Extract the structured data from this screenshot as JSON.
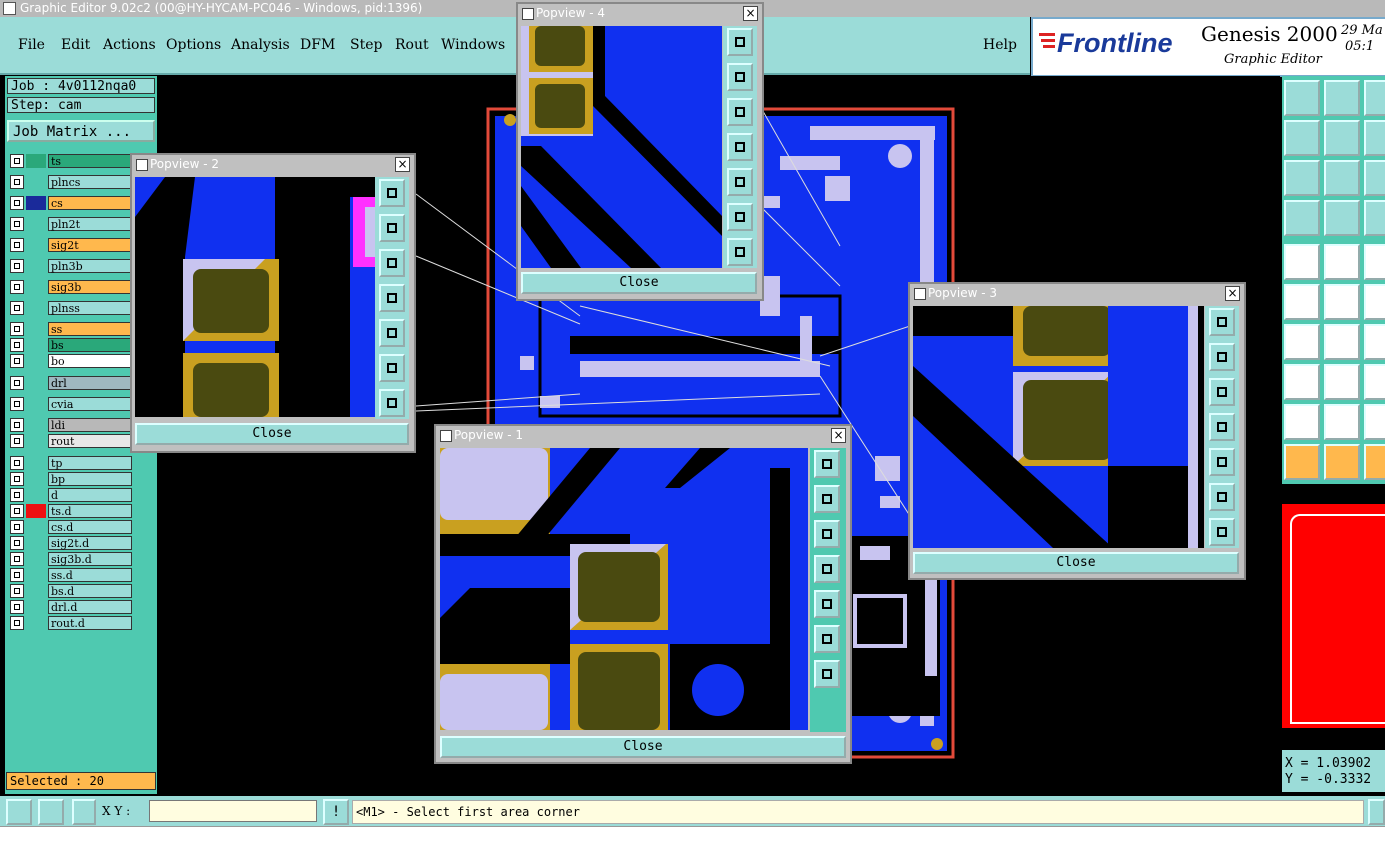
{
  "window": {
    "title": "Graphic Editor 9.02c2 (00@HY-HYCAM-PC046 - Windows, pid:1396)"
  },
  "menu": [
    "File",
    "Edit",
    "Actions",
    "Options",
    "Analysis",
    "DFM",
    "Step",
    "Rout",
    "Windows"
  ],
  "help": "Help",
  "logo": {
    "brand": "Frontline",
    "product": "Genesis 2000",
    "subtitle": "Graphic Editor",
    "date": "29 Ma",
    "time": "05:1"
  },
  "job": {
    "job_label": "Job : 4v0112nqa0",
    "step_label": "Step: cam",
    "matrix_button": "Job Matrix ..."
  },
  "layers": [
    {
      "name": "ts",
      "color": "#2aa87a"
    },
    {
      "name": "plncs",
      "color": "#9bdcd8"
    },
    {
      "name": "cs",
      "color": "#ffb84d"
    },
    {
      "name": "pln2t",
      "color": "#9bdcd8"
    },
    {
      "name": "sig2t",
      "color": "#ffb84d"
    },
    {
      "name": "pln3b",
      "color": "#9bdcd8"
    },
    {
      "name": "sig3b",
      "color": "#ffb84d"
    },
    {
      "name": "plnss",
      "color": "#9bdcd8"
    },
    {
      "name": "ss",
      "color": "#ffb84d"
    },
    {
      "name": "bs",
      "color": "#2aa87a"
    },
    {
      "name": "bo",
      "color": "#ffffff"
    },
    {
      "name": "drl",
      "color": "#9fb8c0"
    },
    {
      "name": "cvia",
      "color": "#9bdcd8"
    },
    {
      "name": "ldi",
      "color": "#b8b8b8"
    },
    {
      "name": "rout",
      "color": "#e8e8e8"
    },
    {
      "name": "tp",
      "color": "#9bdcd8"
    },
    {
      "name": "bp",
      "color": "#9bdcd8"
    },
    {
      "name": "d",
      "color": "#9bdcd8"
    },
    {
      "name": "ts.d",
      "color": "#9bdcd8"
    },
    {
      "name": "cs.d",
      "color": "#9bdcd8"
    },
    {
      "name": "sig2t.d",
      "color": "#9bdcd8"
    },
    {
      "name": "sig3b.d",
      "color": "#9bdcd8"
    },
    {
      "name": "ss.d",
      "color": "#9bdcd8"
    },
    {
      "name": "bs.d",
      "color": "#9bdcd8"
    },
    {
      "name": "drl.d",
      "color": "#9bdcd8"
    },
    {
      "name": "rout.d",
      "color": "#9bdcd8"
    }
  ],
  "selected": "Selected : 20",
  "popups": {
    "p1": {
      "title": "Popview - 1",
      "close": "Close"
    },
    "p2": {
      "title": "Popview - 2",
      "close": "Close"
    },
    "p3": {
      "title": "Popview - 3",
      "close": "Close"
    },
    "p4": {
      "title": "Popview - 4",
      "close": "Close"
    }
  },
  "coords": {
    "x": "X = 1.03902",
    "y": "Y = -0.3332"
  },
  "status": {
    "xy_label": "X Y :",
    "xy_value": "",
    "xy_placeholder": "",
    "prompt": "<M1> - Select first area corner",
    "bottom_text": " "
  }
}
